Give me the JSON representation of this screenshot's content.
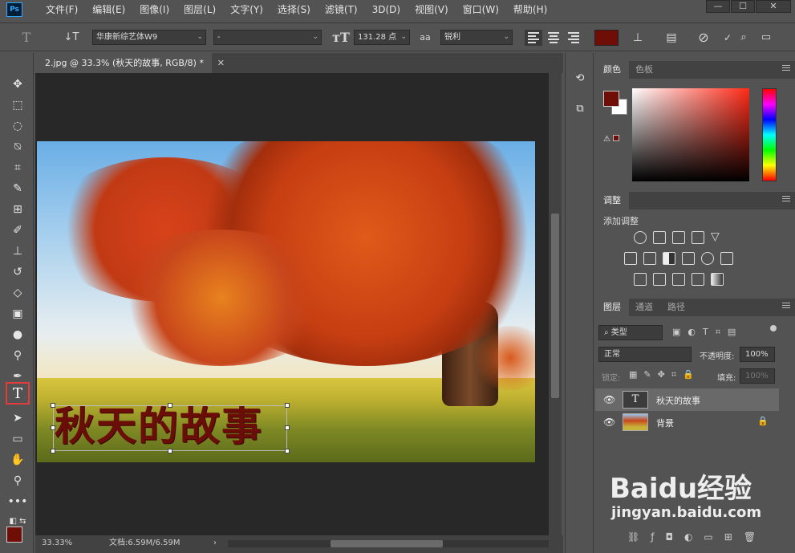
{
  "app": {
    "logo": "Ps"
  },
  "menubar": {
    "items": [
      "文件(F)",
      "编辑(E)",
      "图像(I)",
      "图层(L)",
      "文字(Y)",
      "选择(S)",
      "滤镜(T)",
      "3D(D)",
      "视图(V)",
      "窗口(W)",
      "帮助(H)"
    ],
    "window_controls": [
      "—",
      "☐",
      "✕"
    ]
  },
  "options": {
    "font_family": "华康新综艺体W9",
    "font_style": "-",
    "font_size": "131.28 点",
    "antialias_icon": "aa",
    "antialias": "锐利",
    "text_color": "#6e0e07"
  },
  "document": {
    "tab_title": "2.jpg @ 33.3% (秋天的故事, RGB/8) *",
    "zoom": "33.33%",
    "doc_size": "文档:6.59M/6.59M",
    "image_text": "秋天的故事"
  },
  "panels": {
    "color": {
      "tabs": [
        "颜色",
        "色板"
      ],
      "fg": "#6e0e07",
      "bg": "#ffffff"
    },
    "adjustments": {
      "tab": "调整",
      "label": "添加调整"
    },
    "layers": {
      "tabs": [
        "图层",
        "通道",
        "路径"
      ],
      "filter_kind": "类型",
      "blend_mode": "正常",
      "opacity_label": "不透明度:",
      "opacity": "100%",
      "lock_label": "锁定:",
      "fill_label": "填充:",
      "fill": "100%",
      "items": [
        {
          "name": "秋天的故事",
          "type": "text",
          "selected": true
        },
        {
          "name": "背景",
          "type": "image",
          "selected": false
        }
      ]
    }
  },
  "watermark": {
    "brand": "Baidu经验",
    "url": "jingyan.baidu.com"
  }
}
